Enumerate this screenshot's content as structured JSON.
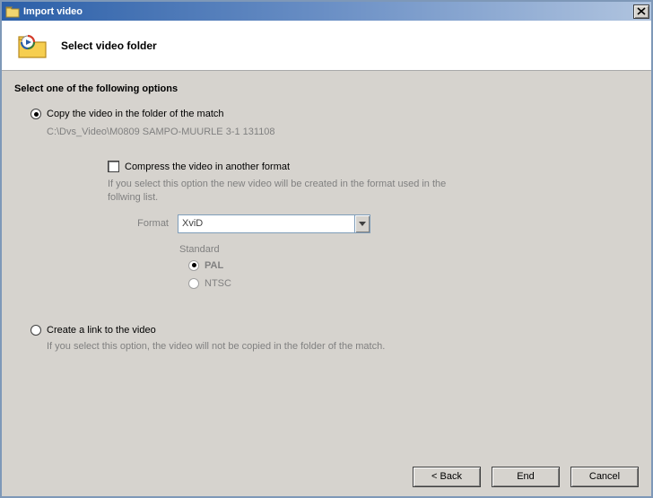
{
  "titlebar": {
    "title": "Import video"
  },
  "header": {
    "title": "Select video folder"
  },
  "section": {
    "heading": "Select one of the following options"
  },
  "option_copy": {
    "label": "Copy the video in the folder of the match",
    "path": "C:\\Dvs_Video\\M0809 SAMPO-MUURLE 3-1 131108",
    "selected": true
  },
  "compress": {
    "label": "Compress the video in another format",
    "help": "If you select this option the new video will be created in the format used in the follwing list.",
    "checked": false
  },
  "format": {
    "label": "Format",
    "value": "XviD"
  },
  "standard": {
    "label": "Standard",
    "options": {
      "pal": "PAL",
      "ntsc": "NTSC"
    },
    "selected": "pal"
  },
  "option_link": {
    "label": "Create a link to the video",
    "help": "If you select this option, the video will not be copied in the folder of the match.",
    "selected": false
  },
  "buttons": {
    "back": "< Back",
    "end": "End",
    "cancel": "Cancel"
  }
}
